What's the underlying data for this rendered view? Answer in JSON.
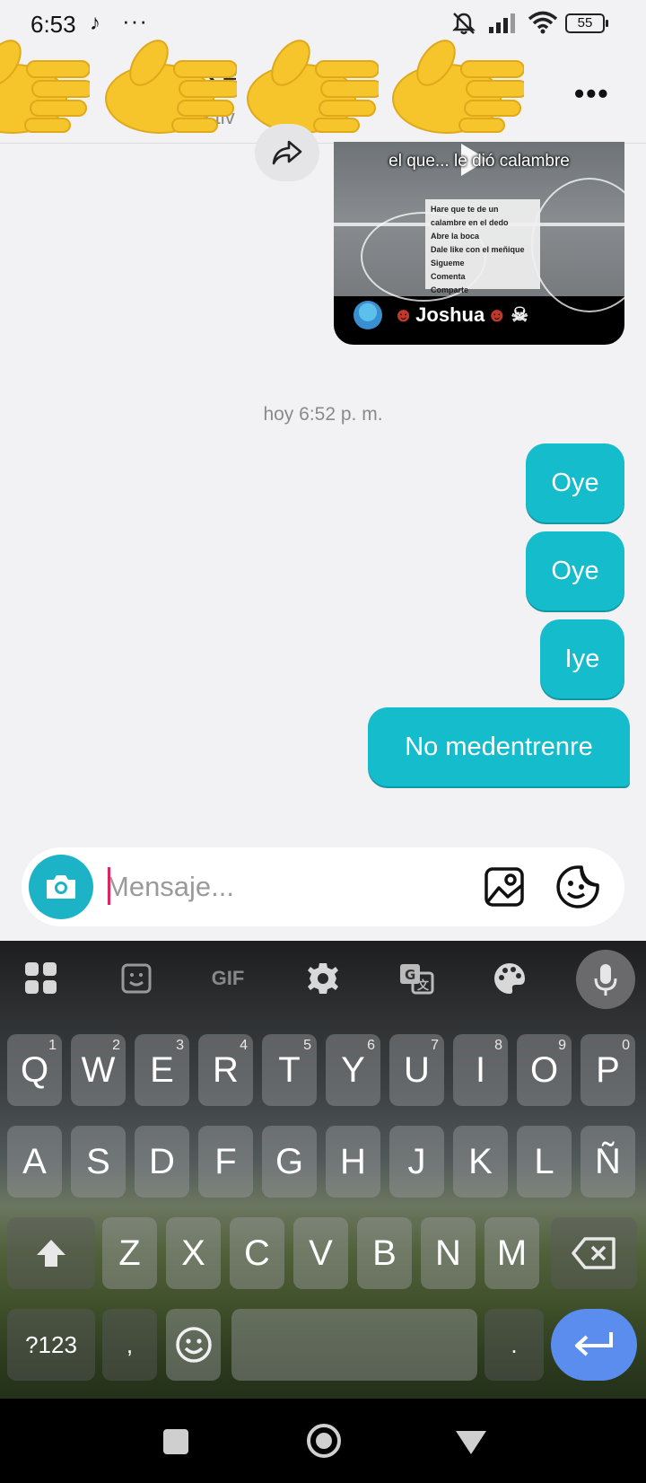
{
  "status_bar": {
    "time": "6:53",
    "tiktok_icon": "tiktok-icon",
    "more": "···",
    "battery": "55",
    "icons": [
      "mute-icon",
      "signal-icon",
      "wifi-icon",
      "battery-icon"
    ]
  },
  "header": {
    "name": "ゞ≡",
    "status": "Activ",
    "more_label": "•••",
    "overlay_emojis": [
      "hand-emoji",
      "hand-emoji",
      "hand-emoji",
      "hand-emoji"
    ]
  },
  "chat": {
    "shared_video": {
      "title": "el que... le dió calambre",
      "note_lines": [
        "Hare que te de un",
        "calambre en el dedo",
        "Abre la boca",
        "Dale like con el meñique",
        "Sigueme",
        "Comenta",
        "Comparte"
      ],
      "author": "Joshua"
    },
    "timestamp": "hoy 6:52 p. m.",
    "messages": [
      {
        "text": "Oye"
      },
      {
        "text": "Oye"
      },
      {
        "text": "Iye"
      },
      {
        "text": "No medentrenre"
      }
    ]
  },
  "composer": {
    "placeholder": "Mensaje..."
  },
  "keyboard": {
    "toolbar": [
      "apps-icon",
      "sticker-icon",
      "GIF",
      "settings-icon",
      "translate-icon",
      "palette-icon",
      "mic-icon"
    ],
    "row1": [
      {
        "key": "Q",
        "num": "1"
      },
      {
        "key": "W",
        "num": "2"
      },
      {
        "key": "E",
        "num": "3"
      },
      {
        "key": "R",
        "num": "4"
      },
      {
        "key": "T",
        "num": "5"
      },
      {
        "key": "Y",
        "num": "6"
      },
      {
        "key": "U",
        "num": "7"
      },
      {
        "key": "I",
        "num": "8"
      },
      {
        "key": "O",
        "num": "9"
      },
      {
        "key": "P",
        "num": "0"
      }
    ],
    "row2": [
      "A",
      "S",
      "D",
      "F",
      "G",
      "H",
      "J",
      "K",
      "L",
      "Ñ"
    ],
    "row3": [
      "Z",
      "X",
      "C",
      "V",
      "B",
      "N",
      "M"
    ],
    "symbols": "?123",
    "comma": ",",
    "period": "."
  },
  "colors": {
    "bubble": "#15bccc",
    "enter": "#5b8def",
    "camera": "#1cb3c6"
  }
}
